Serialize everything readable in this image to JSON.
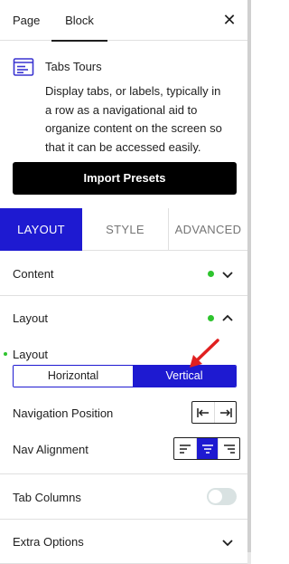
{
  "top_tabs": {
    "page": "Page",
    "block": "Block",
    "close": "✕"
  },
  "block": {
    "title": "Tabs Tours",
    "description": "Display tabs, or labels, typically in a row as a navigational aid to organize content on the screen so that it can be accessed easily."
  },
  "import_button": "Import Presets",
  "sub_tabs": {
    "layout": "LAYOUT",
    "style": "STYLE",
    "advanced": "ADVANCED"
  },
  "sections": {
    "content": "Content",
    "layout": "Layout",
    "layout_field": "Layout",
    "layout_options": {
      "horizontal": "Horizontal",
      "vertical": "Vertical",
      "selected": "Vertical"
    },
    "navigation_position": "Navigation Position",
    "nav_alignment": "Nav Alignment",
    "tab_columns": "Tab Columns",
    "tab_columns_enabled": false,
    "extra_options": "Extra Options"
  },
  "colors": {
    "accent": "#1e1ad1",
    "status_dot": "#2ec42e",
    "arrow": "#e02020"
  }
}
